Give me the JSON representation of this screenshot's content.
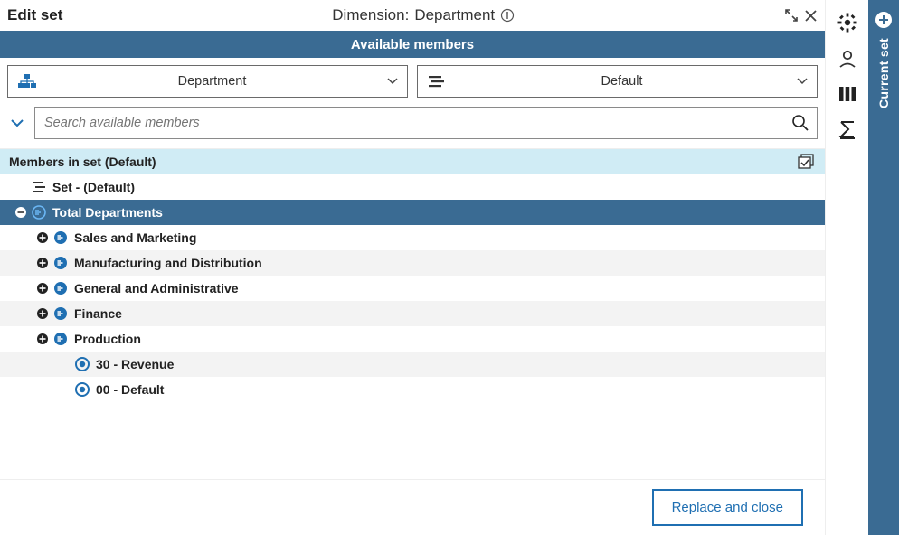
{
  "header": {
    "title": "Edit set",
    "dimension_prefix": "Dimension:",
    "dimension_value": "Department"
  },
  "bar": {
    "title": "Available members"
  },
  "dropdowns": {
    "hierarchy": {
      "label": "Department"
    },
    "subset": {
      "label": "Default"
    }
  },
  "search": {
    "placeholder": "Search available members"
  },
  "section": {
    "title": "Members in set (Default)"
  },
  "tree": {
    "set_label": "Set - (Default)",
    "root": "Total Departments",
    "children": [
      {
        "label": "Sales and Marketing",
        "expandable": true
      },
      {
        "label": "Manufacturing and Distribution",
        "expandable": true
      },
      {
        "label": "General and Administrative",
        "expandable": true
      },
      {
        "label": "Finance",
        "expandable": true
      },
      {
        "label": "Production",
        "expandable": true
      },
      {
        "label": "30 - Revenue",
        "expandable": false
      },
      {
        "label": "00 - Default",
        "expandable": false
      }
    ]
  },
  "footer": {
    "button": "Replace and close"
  },
  "right_tab": {
    "label": "Current set"
  }
}
